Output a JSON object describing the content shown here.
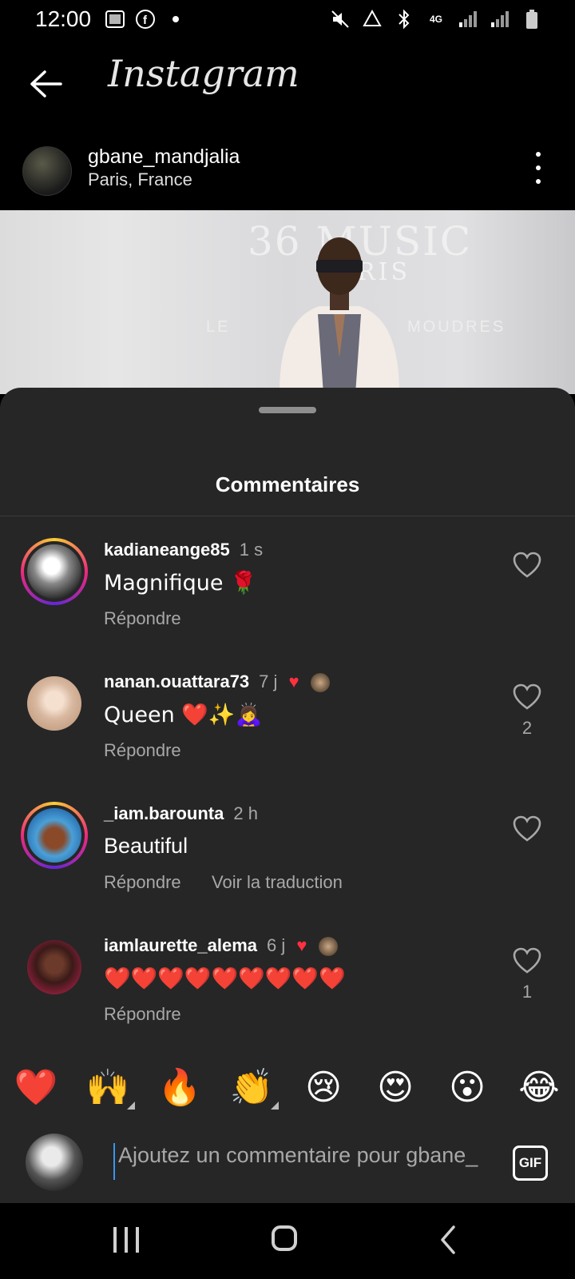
{
  "status_bar": {
    "time": "12:00",
    "network": "4G"
  },
  "header": {
    "app_title": "Instagram"
  },
  "post": {
    "username": "gbane_mandjalia",
    "location": "Paris, France",
    "image_text_1": "36 MUSIC",
    "image_text_2": "PARIS",
    "image_text_3": "LE",
    "image_text_4": "MOUDRES"
  },
  "sheet": {
    "title": "Commentaires",
    "comments": [
      {
        "username": "kadianeange85",
        "time": "1 s",
        "text": "Magnifique 🌹",
        "reply": "Répondre",
        "likes": "",
        "author_liked": false
      },
      {
        "username": "nanan.ouattara73",
        "time": "7 j",
        "text": "Queen ❤️✨🙇‍♀️",
        "reply": "Répondre",
        "likes": "2",
        "author_liked": true
      },
      {
        "username": "_iam.barounta",
        "time": "2 h",
        "text": "Beautiful",
        "reply": "Répondre",
        "translate": "Voir la traduction",
        "likes": "",
        "author_liked": false
      },
      {
        "username": "iamlaurette_alema",
        "time": "6 j",
        "text": "❤️❤️❤️❤️❤️❤️❤️❤️❤️",
        "reply": "Répondre",
        "likes": "1",
        "author_liked": true
      }
    ]
  },
  "reactions": [
    "❤️",
    "🙌",
    "🔥",
    "👏",
    "😢",
    "😍",
    "😮",
    "😂"
  ],
  "composer": {
    "placeholder": "Ajoutez un commentaire pour gbane_",
    "gif_label": "GIF"
  },
  "colors": {
    "background": "#000000",
    "sheet": "#262626",
    "secondary_text": "#a8a8a8",
    "like_red": "#ff3040",
    "cursor_blue": "#3897f0"
  }
}
